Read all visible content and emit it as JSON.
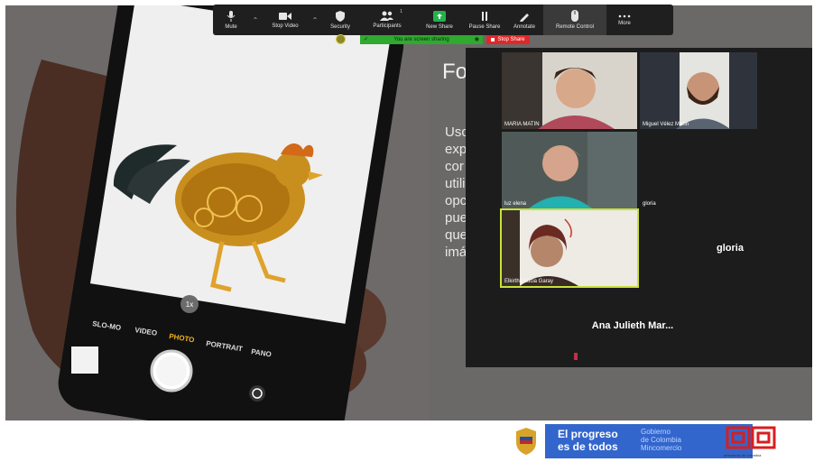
{
  "toolbar": {
    "items": [
      {
        "label": "Mute",
        "icon": "microphone-icon"
      },
      {
        "label": "Stop Video",
        "icon": "video-camera-icon"
      },
      {
        "label": "Security",
        "icon": "shield-icon"
      },
      {
        "label": "Participants",
        "icon": "participants-icon",
        "count": "1"
      },
      {
        "label": "New Share",
        "icon": "share-arrow-icon"
      },
      {
        "label": "Pause Share",
        "icon": "pause-icon"
      },
      {
        "label": "Annotate",
        "icon": "pen-icon"
      },
      {
        "label": "Remote Control",
        "icon": "mouse-icon"
      },
      {
        "label": "More",
        "icon": "more-dots-icon"
      }
    ]
  },
  "share_banner": {
    "status": "You are screen sharing",
    "stop_label": "Stop Share"
  },
  "slide": {
    "title": "Fo",
    "lines": [
      "Usc",
      "exp",
      "cor",
      "utili",
      "opc",
      "pue",
      "que",
      "imá"
    ],
    "camera_modes": [
      "SLO-MO",
      "VIDEO",
      "PHOTO",
      "PORTRAIT",
      "PANO"
    ],
    "zoom_badge": "1x"
  },
  "gallery": {
    "participants": [
      {
        "name": "MARIA MATIN"
      },
      {
        "name": "Miguel Vélez Marin"
      },
      {
        "name": "luz elena"
      },
      {
        "name": "gloria"
      },
      {
        "name": "Elkirtha Lucia Garay"
      },
      {
        "name": "Ana Julieth Mar..."
      }
    ],
    "gloria_big": "gloria"
  },
  "footer": {
    "slogan_line1": "El progreso",
    "slogan_line2": "es de todos",
    "gov_line1": "Gobierno",
    "gov_line2": "de Colombia",
    "gov_line3": "Mincomercio",
    "artesanias_label": "artesanías de colombia"
  },
  "colors": {
    "toolbar_bg": "#1f1f1f",
    "share_green": "#2fa92f",
    "stop_red": "#e02828",
    "gob_blue": "#3366cc",
    "active_speaker": "#c8e23a",
    "artesanias_red": "#d81e1e"
  }
}
